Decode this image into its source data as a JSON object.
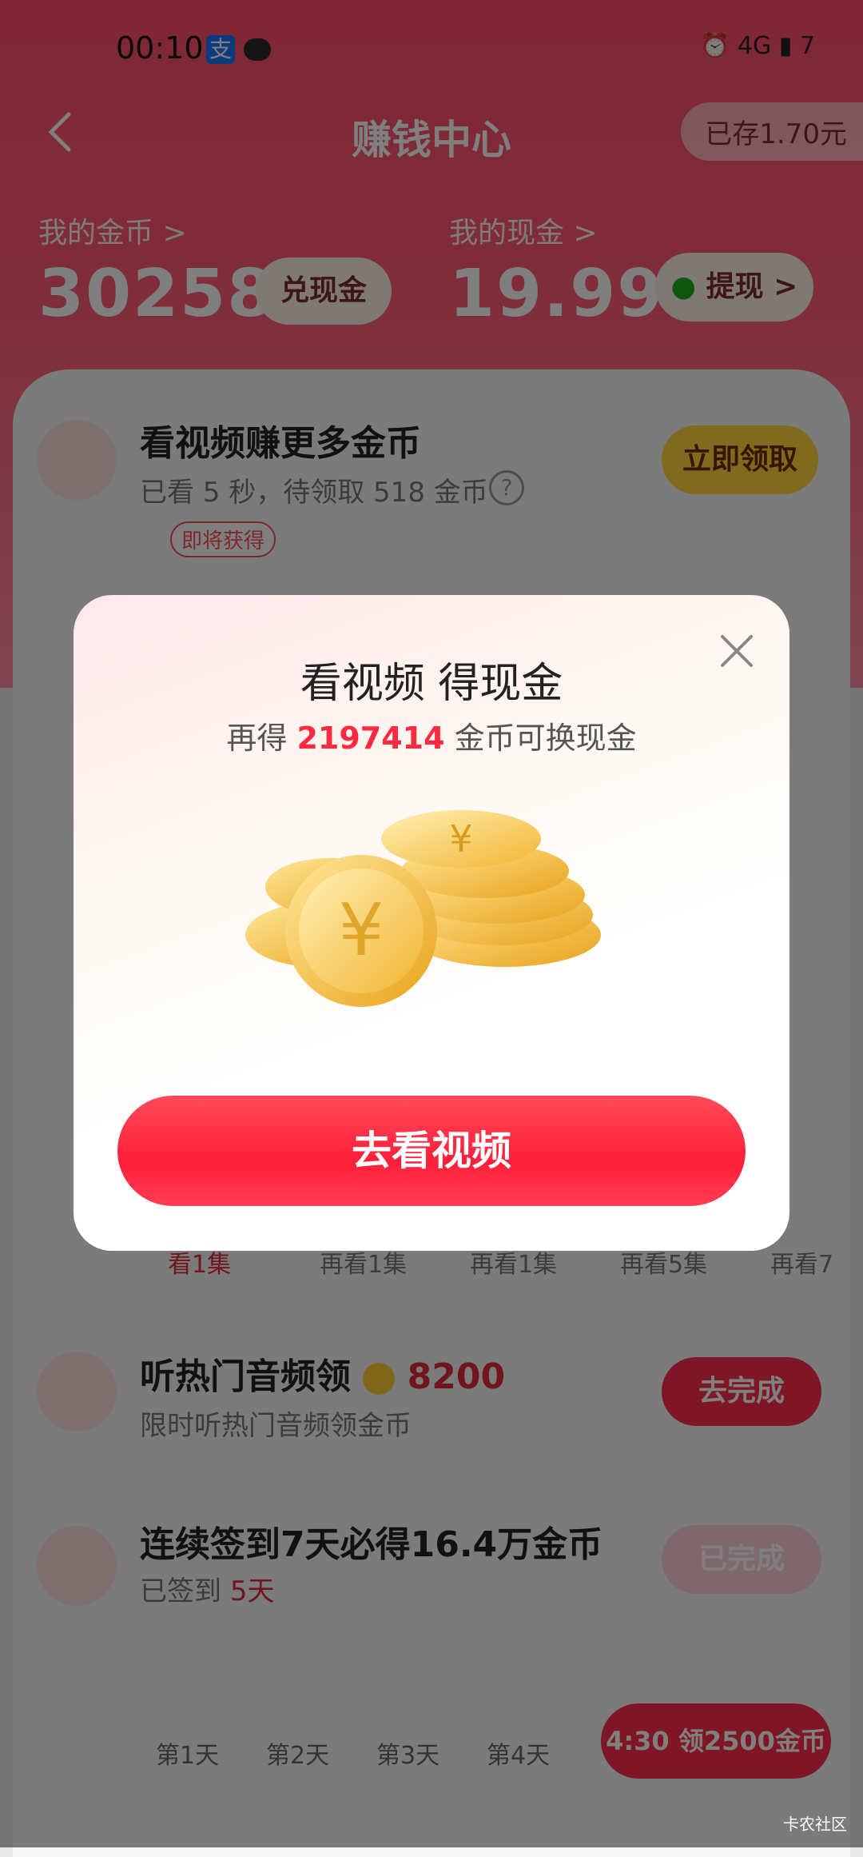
{
  "status": {
    "time": "00:10",
    "battery": "7",
    "signal": "4G"
  },
  "nav": {
    "title": "赚钱中心",
    "saved": "已存1.70元"
  },
  "stats": {
    "coins_label": "我的金币 >",
    "coins_value": "302586",
    "coins_btn": "兑现金",
    "cash_label": "我的现金 >",
    "cash_value": "19.99",
    "cash_btn": "提现 >"
  },
  "video_task": {
    "title": "看视频赚更多金币",
    "sub": "已看 5 秒，待领取 518 金币",
    "btn": "立即领取",
    "tag": "即将获得"
  },
  "audio_task": {
    "title": "听热门音频领",
    "amount": "8200",
    "sub": "限时听热门音频领金币",
    "btn": "去完成"
  },
  "signin_task": {
    "title": "连续签到7天必得16.4万金币",
    "sub_prefix": "已签到",
    "sub_days": "5天",
    "btn": "已完成"
  },
  "signin_days": [
    "第1天",
    "第2天",
    "第3天",
    "第4天"
  ],
  "episodes": [
    "看1集",
    "再看1集",
    "再看1集",
    "再看5集",
    "再看7"
  ],
  "floating": {
    "label": "4:30 领2500金币"
  },
  "modal": {
    "title": "看视频 得现金",
    "sub_prefix": "再得 ",
    "sub_amount": "2197414",
    "sub_suffix": " 金币可换现金",
    "cta": "去看视频"
  },
  "watermark": "卡农社区",
  "colors": {
    "accent": "#ff2d4b",
    "header": "#ff4d6a",
    "highlight": "#ff2a3f"
  }
}
